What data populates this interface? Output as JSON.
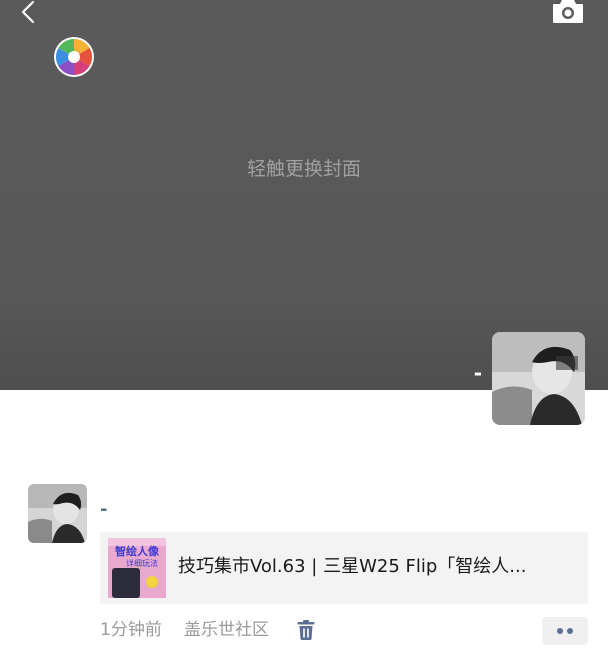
{
  "cover": {
    "hint": "轻触更换封面",
    "back_icon": "chevron-left-icon",
    "camera_icon": "camera-icon",
    "logo_icon": "aperture-logo-icon"
  },
  "profile": {
    "name": "-",
    "avatar_icon": "avatar-photo"
  },
  "post": {
    "author": "-",
    "share": {
      "title": "技巧集市Vol.63 | 三星W25 Flip「智绘人...",
      "thumb_text_1": "智绘人像",
      "thumb_text_2": "详细玩法"
    },
    "time": "1分钟前",
    "source": "盖乐世社区",
    "delete_icon": "trash-icon",
    "more_icon": "more-dots-icon"
  },
  "colors": {
    "cover_bg": "#585858",
    "name_link": "#5a6b94",
    "meta_text": "#9a9a9a"
  }
}
